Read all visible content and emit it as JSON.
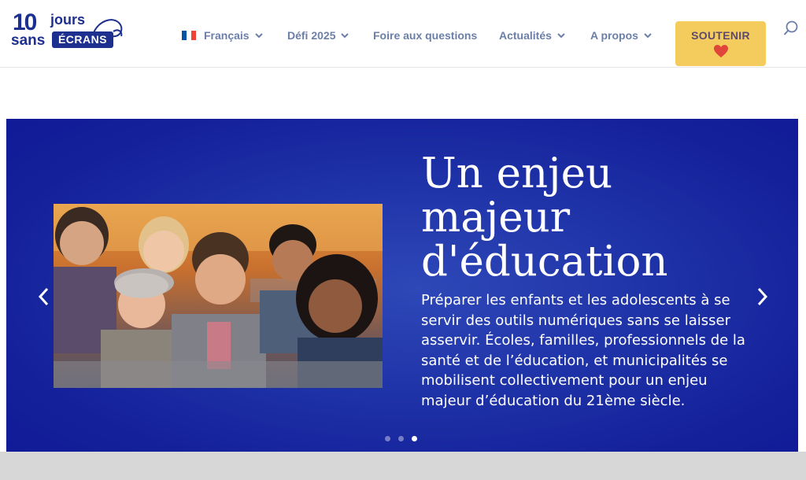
{
  "logo": {
    "ten": "10",
    "jours": "jours",
    "sans": "sans",
    "ecrans": "ÉCRANS"
  },
  "nav": {
    "language": {
      "label": "Français",
      "flag_colors": [
        "#0055a4",
        "#ffffff",
        "#ef4135"
      ]
    },
    "defi": {
      "label": "Défi 2025"
    },
    "faq": {
      "label": "Foire aux questions"
    },
    "actualites": {
      "label": "Actualités"
    },
    "apropos": {
      "label": "A propos"
    },
    "cta": {
      "label": "SOUTENIR",
      "icon": "heart-icon"
    },
    "search": {
      "icon": "search-icon"
    }
  },
  "slider": {
    "title": "Un enjeu majeur d'éducation",
    "text": "Préparer les enfants et les adolescents à se servir des outils numériques sans se laisser asservir. Écoles, familles, professionnels de la santé et de l’éducation, et municipalités se mobilisent collectivement pour un enjeu majeur d’éducation du 21ème siècle.",
    "image_alt": "photo-teens-selfie",
    "dots": 3,
    "active_dot": 3
  },
  "colors": {
    "brand": "#1d2f8f",
    "nav_text": "#6b7fa8",
    "cta_bg": "#f4cc5e",
    "slider_bg": "#1f33a8"
  }
}
